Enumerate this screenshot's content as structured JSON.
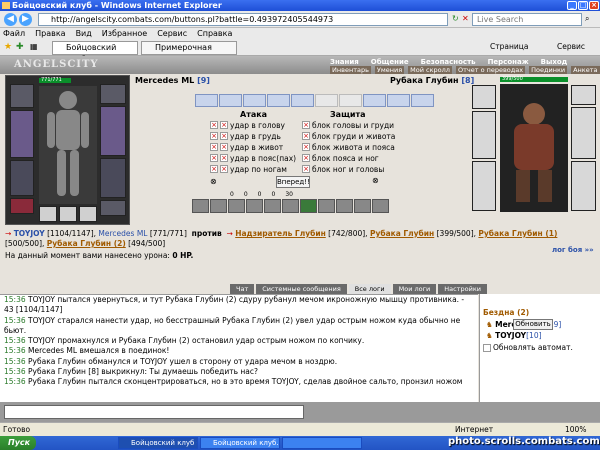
{
  "window": {
    "title": "Бойцовский клуб - Windows Internet Explorer"
  },
  "address": {
    "url": "http://angelscity.combats.com/buttons.pl?battle=0.493972405544973",
    "search_placeholder": "Live Search"
  },
  "menu": [
    "Файл",
    "Правка",
    "Вид",
    "Избранное",
    "Сервис",
    "Справка"
  ],
  "browser_tabs": [
    {
      "label": "Бойцовский клуб"
    },
    {
      "label": "Примерочная DarkClan"
    }
  ],
  "toolbar_right": {
    "page": "Страница",
    "service": "Сервис"
  },
  "game": {
    "logo": "ANGELSCITY",
    "top_nav": [
      "Знания",
      "Общение",
      "Безопасность",
      "Персонаж",
      "Выход"
    ],
    "sub_nav": [
      "Инвентарь",
      "Умения",
      "Мой скролл",
      "Отчет о переводах",
      "Поединки",
      "Анкета"
    ],
    "left_player": {
      "name": "Mercedes ML",
      "level": "[9]",
      "hp": "771/771"
    },
    "right_player": {
      "name": "Рубака Глубин",
      "level": "[8]",
      "hp": "399/500"
    },
    "attack_title": "Атака",
    "defense_title": "Защита",
    "attack_options": [
      "удар в голову",
      "удар в грудь",
      "удар в живот",
      "удар в пояс(пах)",
      "удар по ногам"
    ],
    "defense_options": [
      "блок головы и груди",
      "блок груди и живота",
      "блок живота и пояса",
      "блок пояса и ног",
      "блок ног и головы"
    ],
    "forward_button": "Вперед!!",
    "counters": [
      "0",
      "0",
      "0",
      "0",
      "30"
    ],
    "team1": [
      {
        "name": "TOYJOY",
        "hp": "[1104/1147]"
      },
      {
        "name": "Mercedes ML",
        "hp": "[771/771]"
      }
    ],
    "versus": "против",
    "team2": [
      {
        "name": "Надзиратель Глубин",
        "hp": "[742/800]"
      },
      {
        "name": "Рубака Глубин",
        "hp": "[399/500]"
      },
      {
        "name": "Рубака Глубин (1)",
        "hp": "[500/500]"
      },
      {
        "name": "Рубака Глубин (2)",
        "hp": "[494/500]"
      }
    ],
    "damage_text": "На данный момент вами нанесено урона: ",
    "damage_value": "0 HP.",
    "battle_log_link": "лог боя »»"
  },
  "chat": {
    "tabs": [
      "Чат",
      "Системные сообщения",
      "Все логи",
      "Мои логи",
      "Настройки"
    ],
    "selected_tab": "Все логи",
    "lines": [
      {
        "time": "15:36",
        "text": "TOYJOY пытался увернуться, и тут Рубака Глубин (2) сдуру рубанул мечом икроножную мышцу противника. -"
      },
      {
        "time": "",
        "text": "43 [1104/1147]"
      },
      {
        "time": "15:36",
        "text": "TOYJOY старался нанести удар, но бесстрашный Рубака Глубин (2) увел удар острым ножом куда обычно не"
      },
      {
        "time": "",
        "text": "бьют."
      },
      {
        "time": "15:36",
        "text": "TOYJOY промахнулся и Рубака Глубин (2) остановил удар острым ножом по копчику."
      },
      {
        "time": "15:36",
        "text": "Mercedes ML вмешался в поединок!"
      },
      {
        "time": "15:36",
        "text": "Рубака Глубин обманулся и TOYJOY ушел в сторону от удара мечом в ноздрю."
      },
      {
        "time": "15:36",
        "text": "Рубака Глубин [8] выкрикнул: Ты думаешь победить нас?"
      },
      {
        "time": "15:36",
        "text": "Рубака Глубин пытался сконцентрироваться, но в это время TOYJOY, сделав двойное сальто, пронзил ножом"
      }
    ],
    "side_title": "Бездна (2)",
    "refresh_button": "Обновить",
    "online": [
      {
        "name": "Mercedes ML",
        "level": "[9]"
      },
      {
        "name": "TOYJOY",
        "level": "[10]"
      }
    ],
    "auto_refresh_label": "Обновлять автомат."
  },
  "status": {
    "text": "Готово",
    "zone": "Интернет",
    "zoom": "100%"
  },
  "taskbar": {
    "start": "Пуск",
    "tasks": [
      "Бойцовский клуб - ...",
      "Бойцовский клуб. Фору...",
      ""
    ]
  },
  "watermark": "photo.scrolls.combats.com"
}
